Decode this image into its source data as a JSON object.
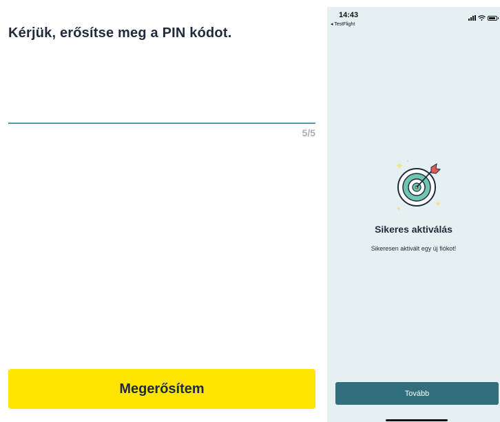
{
  "left_screen": {
    "title": "Kérjük, erősítse meg a PIN kódot.",
    "pin_input": {
      "value": "",
      "counter": "5/5"
    },
    "confirm_button_label": "Megerősítem",
    "colors": {
      "accent": "#ffe500",
      "underline": "#4e9ab4",
      "text": "#1f2a3c"
    }
  },
  "right_screen": {
    "status_bar": {
      "time": "14:43",
      "back_app": "◂ TestFlight",
      "icons": [
        "signal-icon",
        "wifi-icon",
        "battery-icon"
      ]
    },
    "illustration": "target-with-arrow-icon",
    "success_title": "Sikeres aktiválás",
    "success_message": "Sikeresen aktivált egy új fiókot!",
    "next_button_label": "Tovább",
    "colors": {
      "background": "#e4f0f1",
      "button": "#336e7c"
    }
  }
}
